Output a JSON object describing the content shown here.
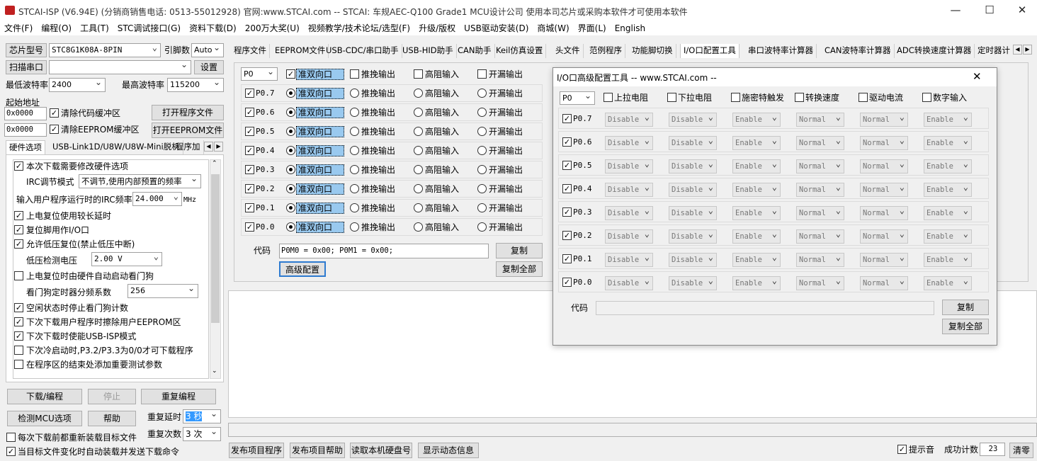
{
  "window": {
    "title": "STCAI-ISP (V6.94E) (分销商销售电话: 0513-55012928) 官网:www.STCAI.com  -- STCAI: 车规AEC-Q100 Grade1 MCU设计公司 使用本司芯片或采购本软件才可使用本软件",
    "min": "—",
    "max": "☐",
    "close": "✕"
  },
  "menu": [
    "文件(F)",
    "编程(O)",
    "工具(T)",
    "STC调试接口(G)",
    "资料下载(D)",
    "200万大奖(U)",
    "视频教学/技术论坛/选型(F)",
    "升级/版权",
    "USB驱动安装(D)",
    "商城(W)",
    "界面(L)",
    "English"
  ],
  "left": {
    "chip_label": "芯片型号",
    "chip_value": "STC8G1K08A-8PIN",
    "pins_label": "引脚数",
    "pins_value": "Auto",
    "scan_button": "扫描串口",
    "port_value": "",
    "settings_button": "设置",
    "min_baud_label": "最低波特率",
    "min_baud": "2400",
    "max_baud_label": "最高波特率",
    "max_baud": "115200",
    "start_addr_label": "起始地址",
    "addr1": "0x0000",
    "clear_code": "清除代码缓冲区",
    "open_prog": "打开程序文件",
    "addr2": "0x0000",
    "clear_eeprom": "清除EEPROM缓冲区",
    "open_eeprom": "打开EEPROM文件",
    "tabs": [
      "硬件选项",
      "USB-Link1D/U8W/U8W-Mini脱机",
      "程序加"
    ],
    "opts": {
      "o1": "本次下载需要修改硬件选项",
      "irc_mode_label": "IRC调节模式",
      "irc_mode_value": "不调节,使用内部预置的频率",
      "irc_freq_label": "输入用户程序运行时的IRC频率",
      "irc_freq_value": "24.000",
      "mhz": "MHz",
      "o2": "上电复位使用较长延时",
      "o3": "复位脚用作I/O口",
      "o4": "允许低压复位(禁止低压中断)",
      "lv_label": "低压检测电压",
      "lv_value": "2.00 V",
      "o5": "上电复位时由硬件自动启动看门狗",
      "wdt_label": "看门狗定时器分频系数",
      "wdt_value": "256",
      "o6": "空闲状态时停止看门狗计数",
      "o7": "下次下载用户程序时擦除用户EEPROM区",
      "o8": "下次下载时使能USB-ISP模式",
      "o9": "下次冷启动时,P3.2/P3.3为0/0才可下载程序",
      "o10": "在程序区的结束处添加重要测试参数"
    },
    "download_button": "下载/编程",
    "stop_button": "停止",
    "reprogram_button": "重复编程",
    "check_mcu_button": "检测MCU选项",
    "help_button": "帮助",
    "repeat_delay_label": "重复延时",
    "repeat_delay_value": "3 秒",
    "repeat_count_label": "重复次数",
    "repeat_count_value": "3 次",
    "reload_each": "每次下载前都重新装载目标文件",
    "auto_reload": "当目标文件变化时自动装载并发送下载命令"
  },
  "tabs": [
    "程序文件",
    "EEPROM文件",
    "USB-CDC/串口助手",
    "USB-HID助手",
    "CAN助手",
    "Keil仿真设置",
    "头文件",
    "范例程序",
    "功能脚切换",
    "I/O口配置工具",
    "串口波特率计算器",
    "CAN波特率计算器",
    "ADC转换速度计算器",
    "定时器计"
  ],
  "io": {
    "port_value": "P0",
    "modes": [
      "准双向口",
      "推挽输出",
      "高阻输入",
      "开漏输出"
    ],
    "pins": [
      "P0.7",
      "P0.6",
      "P0.5",
      "P0.4",
      "P0.3",
      "P0.2",
      "P0.1",
      "P0.0"
    ],
    "code_label": "代码",
    "code_value": "P0M0 = 0x00; P0M1 = 0x00;",
    "copy": "复制",
    "advanced": "高级配置",
    "copy_all": "复制全部"
  },
  "dialog": {
    "title": "I/O口高级配置工具 -- www.STCAI.com --",
    "close": "✕",
    "port_value": "P0",
    "headers": [
      "上拉电阻",
      "下拉电阻",
      "施密特触发",
      "转换速度",
      "驱动电流",
      "数字输入"
    ],
    "values": [
      "Disable",
      "Disable",
      "Enable",
      "Normal",
      "Normal",
      "Enable"
    ],
    "pins": [
      "P0.7",
      "P0.6",
      "P0.5",
      "P0.4",
      "P0.3",
      "P0.2",
      "P0.1",
      "P0.0"
    ],
    "code_label": "代码",
    "code_value": "",
    "copy": "复制",
    "copy_all": "复制全部"
  },
  "bottom": {
    "b1": "发布项目程序",
    "b2": "发布项目帮助",
    "b3": "读取本机硬盘号",
    "b4": "显示动态信息",
    "beep": "提示音",
    "success_label": "成功计数",
    "success_value": "23",
    "clear": "清零"
  }
}
